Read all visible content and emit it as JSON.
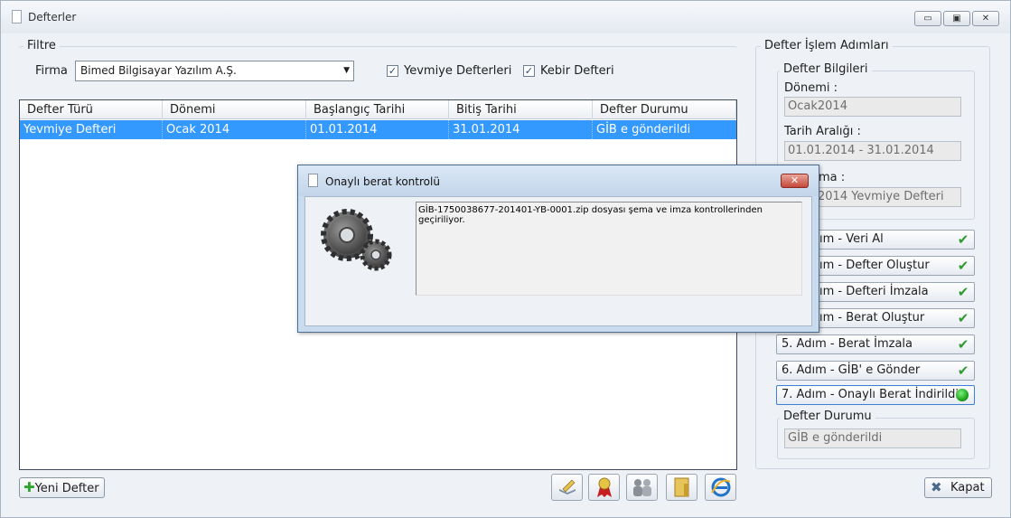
{
  "window": {
    "title": "Defterler",
    "min_label": "▭",
    "max_label": "▣",
    "close_label": "✕"
  },
  "filter": {
    "group_title": "Filtre",
    "firma_label": "Firma",
    "firma_value": "Bimed Bilgisayar Yazılım A.Ş.",
    "yevmiye_label": "Yevmiye Defterleri",
    "kebir_label": "Kebir Defteri"
  },
  "grid": {
    "columns": [
      "Defter Türü",
      "Dönemi",
      "Başlangıç Tarihi",
      "Bitiş Tarihi",
      "Defter Durumu"
    ],
    "rows": [
      [
        "Yevmiye Defteri",
        "Ocak 2014",
        "01.01.2014",
        "31.01.2014",
        "GİB e gönderildi"
      ]
    ]
  },
  "buttons": {
    "new": "Yeni Defter",
    "close": "Kapat"
  },
  "right_panel": {
    "title": "Defter İşlem Adımları",
    "info_title": "Defter Bilgileri",
    "donem_label": "Dönemi :",
    "donem_value": "Ocak2014",
    "tarih_label": "Tarih Aralığı :",
    "tarih_value": "01.01.2014 - 31.01.2014",
    "aciklama_label": "ma :",
    "aciklama_value": "2014 Yevmiye Defteri",
    "steps": [
      {
        "label": "ım - Veri Al",
        "done": true
      },
      {
        "label": "ım - Defter Oluştur",
        "done": true
      },
      {
        "label": "ım - Defteri İmzala",
        "done": true
      },
      {
        "label": "ım - Berat Oluştur",
        "done": true
      },
      {
        "label": "5. Adım - Berat İmzala",
        "done": true
      },
      {
        "label": "6. Adım - GİB' e Gönder",
        "done": true
      },
      {
        "label": "7. Adım - Onaylı Berat İndirildi",
        "done": false
      }
    ],
    "status_title": "Defter Durumu",
    "status_value": "GİB e gönderildi"
  },
  "dialog": {
    "title": "Onaylı berat kontrolü",
    "message": "GİB-1750038677-201401-YB-0001.zip dosyası şema ve imza kontrollerinden geçiriliyor.",
    "close_label": "✕"
  },
  "colors": {
    "selection": "#3399ff",
    "check": "#2f9a2f",
    "dialog_frame": "#c9dbee"
  }
}
